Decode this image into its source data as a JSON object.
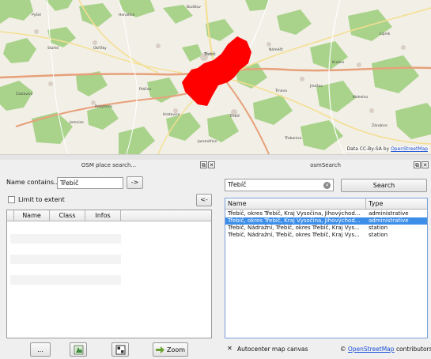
{
  "map": {
    "attribution_prefix": "Data CC-By-SA by",
    "attribution_link": "OpenStreetMap",
    "place_labels": [
      "Třebíč",
      "Budišov",
      "Stařeč",
      "Hrotovice",
      "Okříšky",
      "Jaroměřice",
      "Rokytnice",
      "Náměšť",
      "Jemnice",
      "Čáslavice",
      "Pyšel",
      "Kralice",
      "Jinošov",
      "Mohelno",
      "Lipník",
      "Zárubice",
      "Ptáčov",
      "Trnava",
      "Třebenice",
      "Heraltice"
    ],
    "colors": {
      "background": "#f2efe6",
      "forest": "#a9d38b",
      "highlight": "#ff0000",
      "road_primary": "#e7a07a",
      "road_secondary": "#f5df92"
    }
  },
  "left_panel": {
    "title": "OSM place search...",
    "float_icon": "restore-icon",
    "close_icon": "close-icon",
    "name_label": "Name contains...",
    "name_value": "Třebíč",
    "go_button": "->",
    "limit_label": "Limit to extent",
    "limit_checked": false,
    "back_button": "<-",
    "columns": [
      "Name",
      "Class",
      "Infos"
    ],
    "bottom_buttons": {
      "more": "...",
      "zoom_label": "Zoom"
    }
  },
  "right_panel": {
    "title": "osmSearch",
    "float_icon": "restore-icon",
    "close_icon": "close-icon",
    "search_value": "Třebíč",
    "search_button": "Search",
    "columns": [
      "Name",
      "Type"
    ],
    "rows": [
      {
        "name": "Třebíč, okres Třebíč, Kraj Vysočina, Jihovýchod...",
        "type": "administrative",
        "selected": false
      },
      {
        "name": "Třebíč, okres Třebíč, Kraj Vysočina, Jihovýchod...",
        "type": "administrative",
        "selected": true
      },
      {
        "name": "Třebíč, Nádražní, Třebíč, okres Třebíč, Kraj Vys...",
        "type": "station",
        "selected": false
      },
      {
        "name": "Třebíč, Nádražní, Třebíč, okres Třebíč, Kraj Vys...",
        "type": "station",
        "selected": false
      }
    ],
    "autocenter_label": "Autocenter map canvas",
    "autocenter_checked": true,
    "copyright_symbol": "©",
    "copyright_link": "OpenStreetMap",
    "copyright_suffix": "contributors",
    "selection_color": "#3d8ee8"
  }
}
